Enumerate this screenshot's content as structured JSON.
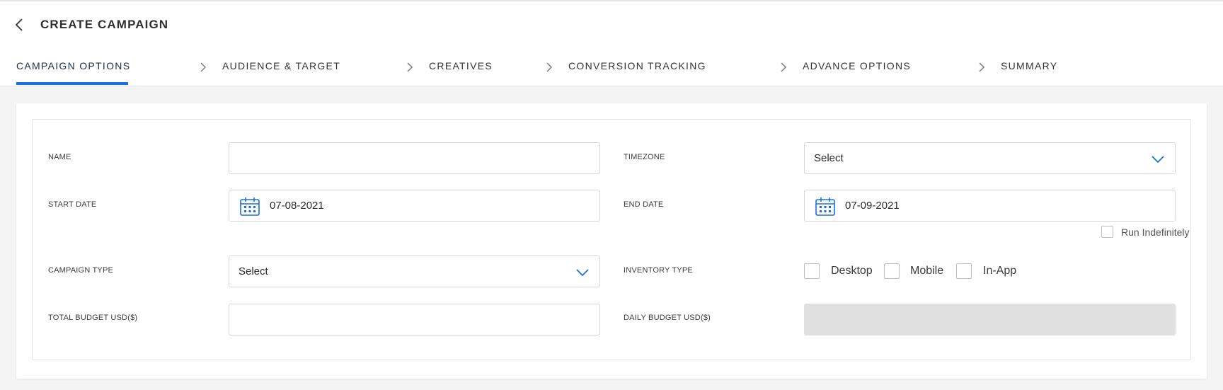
{
  "header": {
    "title": "CREATE CAMPAIGN",
    "back_icon": "chevron-left-icon"
  },
  "steps": [
    {
      "label": "CAMPAIGN OPTIONS",
      "active": true
    },
    {
      "label": "AUDIENCE & TARGET",
      "active": false
    },
    {
      "label": "CREATIVES",
      "active": false
    },
    {
      "label": "CONVERSION TRACKING",
      "active": false
    },
    {
      "label": "ADVANCE OPTIONS",
      "active": false
    },
    {
      "label": "SUMMARY",
      "active": false
    }
  ],
  "form": {
    "name": {
      "label": "NAME",
      "value": ""
    },
    "timezone": {
      "label": "TIMEZONE",
      "value": "Select"
    },
    "start_date": {
      "label": "START DATE",
      "value": "07-08-2021"
    },
    "end_date": {
      "label": "END DATE",
      "value": "07-09-2021"
    },
    "run_indefinitely": {
      "label": "Run Indefinitely",
      "checked": false
    },
    "campaign_type": {
      "label": "CAMPAIGN TYPE",
      "value": "Select"
    },
    "inventory_type": {
      "label": "INVENTORY TYPE",
      "options": [
        {
          "label": "Desktop",
          "checked": false
        },
        {
          "label": "Mobile",
          "checked": false
        },
        {
          "label": "In-App",
          "checked": false
        }
      ]
    },
    "total_budget": {
      "label": "TOTAL BUDGET USD($)",
      "value": ""
    },
    "daily_budget": {
      "label": "DAILY BUDGET USD($)",
      "value": ""
    }
  },
  "colors": {
    "accent": "#1a6fde",
    "page_bg": "#f4f4f4",
    "disabled_field": "#e1e1e1"
  }
}
